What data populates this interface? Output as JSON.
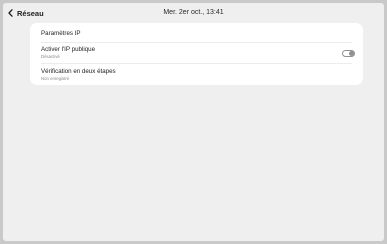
{
  "header": {
    "back_label": "Réseau",
    "status_time": "Mer. 2er oct., 13:41"
  },
  "settings": {
    "items": [
      {
        "title": "Paramètres IP"
      },
      {
        "title": "Activer l'IP publique",
        "subtitle": "Désactivé",
        "toggle_state": "off"
      },
      {
        "title": "Vérification en deux étapes",
        "subtitle": "Non enregistré"
      }
    ]
  },
  "colors": {
    "background": "#efefef",
    "card": "#ffffff",
    "text_primary": "#1e1e1e",
    "text_secondary": "#8a8a8a",
    "toggle": "#8f8f8f"
  },
  "icons": {
    "back": "chevron-left-icon",
    "toggle": "toggle-switch"
  }
}
